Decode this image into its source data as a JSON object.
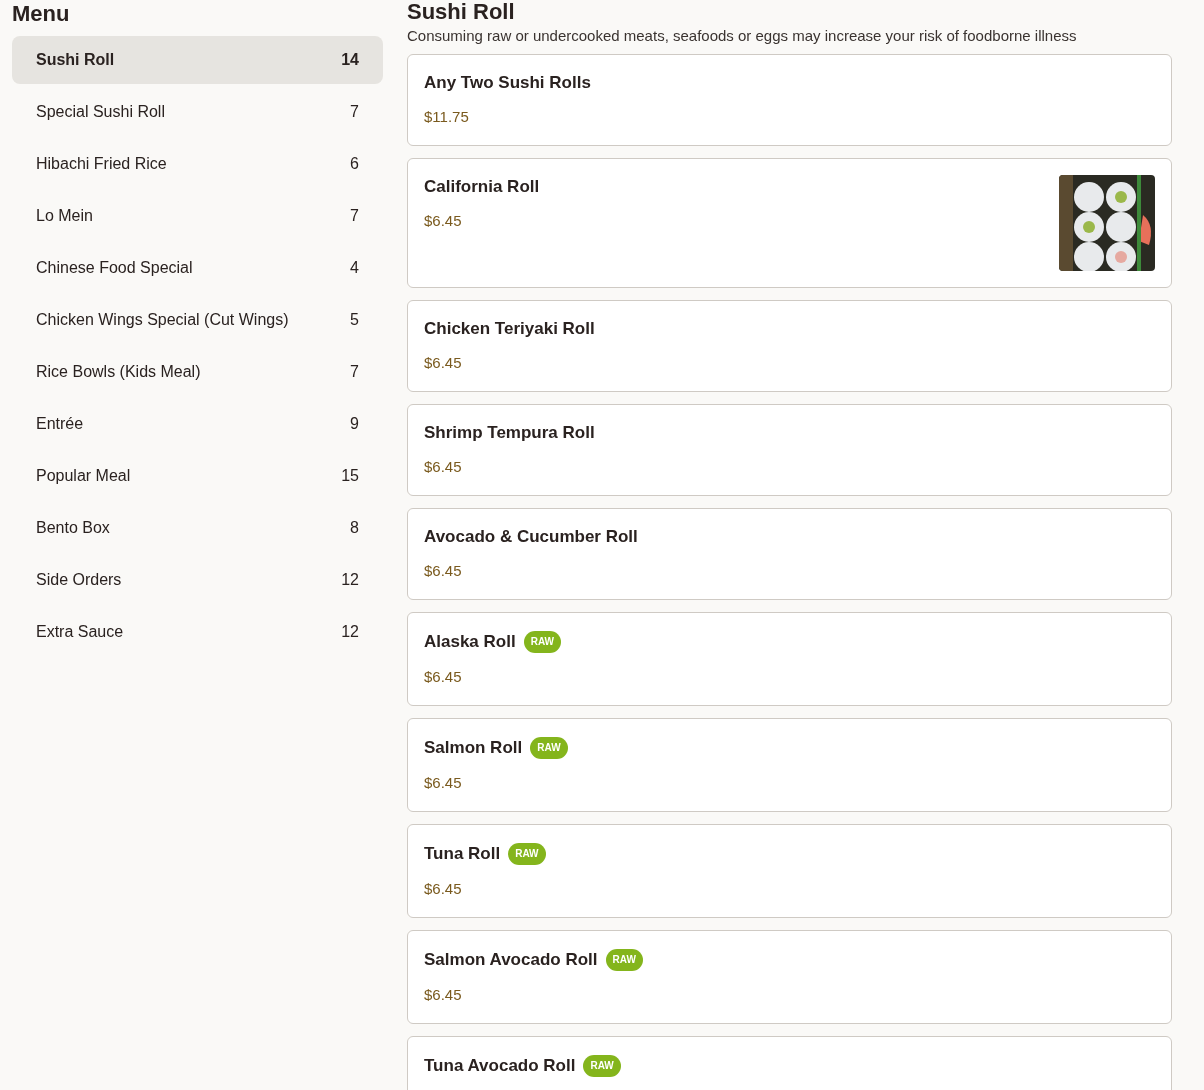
{
  "sidebar": {
    "title": "Menu",
    "items": [
      {
        "label": "Sushi Roll",
        "count": "14",
        "selected": true
      },
      {
        "label": "Special Sushi Roll",
        "count": "7",
        "selected": false
      },
      {
        "label": "Hibachi Fried Rice",
        "count": "6",
        "selected": false
      },
      {
        "label": "Lo Mein",
        "count": "7",
        "selected": false
      },
      {
        "label": "Chinese Food Special",
        "count": "4",
        "selected": false
      },
      {
        "label": "Chicken Wings Special (Cut Wings)",
        "count": "5",
        "selected": false
      },
      {
        "label": "Rice Bowls (Kids Meal)",
        "count": "7",
        "selected": false
      },
      {
        "label": "Entrée",
        "count": "9",
        "selected": false
      },
      {
        "label": "Popular Meal",
        "count": "15",
        "selected": false
      },
      {
        "label": "Bento Box",
        "count": "8",
        "selected": false
      },
      {
        "label": "Side Orders",
        "count": "12",
        "selected": false
      },
      {
        "label": "Extra Sauce",
        "count": "12",
        "selected": false
      }
    ]
  },
  "section": {
    "title": "Sushi Roll",
    "note": "Consuming raw or undercooked meats, seafoods or eggs may increase your risk of foodborne illness",
    "items": [
      {
        "name": "Any Two Sushi Rolls",
        "price": "$11.75"
      },
      {
        "name": "California Roll",
        "price": "$6.45"
      },
      {
        "name": "Chicken Teriyaki Roll",
        "price": "$6.45"
      },
      {
        "name": "Shrimp Tempura Roll",
        "price": "$6.45"
      },
      {
        "name": "Avocado & Cucumber Roll",
        "price": "$6.45"
      },
      {
        "name": "Alaska Roll",
        "badge": "RAW",
        "price": "$6.45"
      },
      {
        "name": "Salmon Roll",
        "badge": "RAW",
        "price": "$6.45"
      },
      {
        "name": "Tuna Roll",
        "badge": "RAW",
        "price": "$6.45"
      },
      {
        "name": "Salmon Avocado Roll",
        "badge": "RAW",
        "price": "$6.45"
      },
      {
        "name": "Tuna Avocado Roll",
        "badge": "RAW"
      }
    ]
  }
}
